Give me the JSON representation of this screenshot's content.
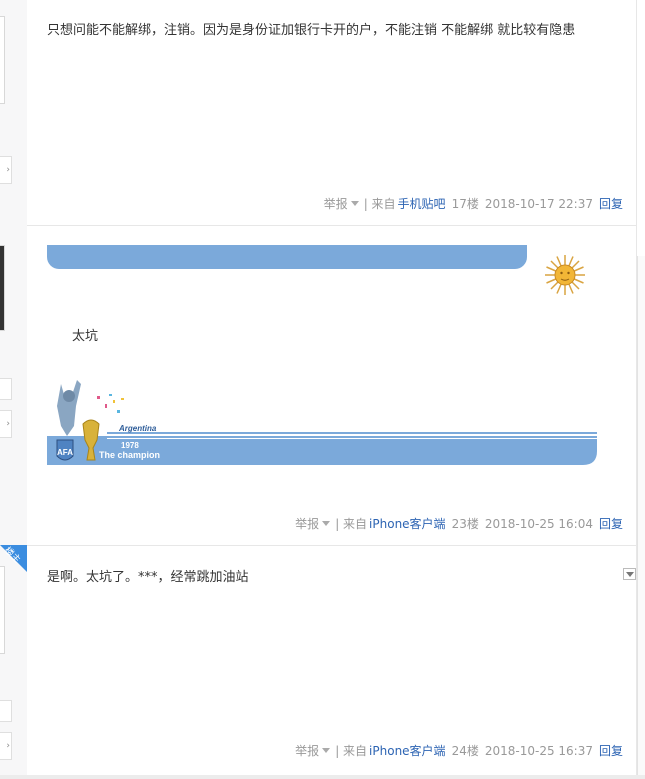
{
  "posts": [
    {
      "content": "只想问能不能解绑，注销。因为是身份证加银行卡开的户，不能注销 不能解绑 就比较有隐患",
      "report": "举报",
      "source_prefix": "| 来自",
      "source": "手机贴吧",
      "floor": "17楼",
      "date": "2018-10-17 22:37",
      "reply": "回复"
    },
    {
      "content": "太坑",
      "banner": {
        "country": "Argentina",
        "year": "1978",
        "caption": "The champion",
        "crest_text": "AFA"
      },
      "report": "举报",
      "source_prefix": "| 来自",
      "source": "iPhone客户端",
      "floor": "23楼",
      "date": "2018-10-25 16:04",
      "reply": "回复"
    },
    {
      "badge": "楼主",
      "content": "是啊。太坑了。***，经常跳加油站",
      "report": "举报",
      "source_prefix": "| 来自",
      "source": "iPhone客户端",
      "floor": "24楼",
      "date": "2018-10-25 16:37",
      "reply": "回复"
    }
  ],
  "colors": {
    "link": "#2d64b3",
    "meta": "#999999",
    "sig_blue": "#7ba9da",
    "badge_blue": "#3b8de0"
  },
  "icons": {
    "report_caret": "caret-down-icon",
    "sun": "sun-of-may-icon",
    "collapse": "collapse-arrow-icon"
  }
}
